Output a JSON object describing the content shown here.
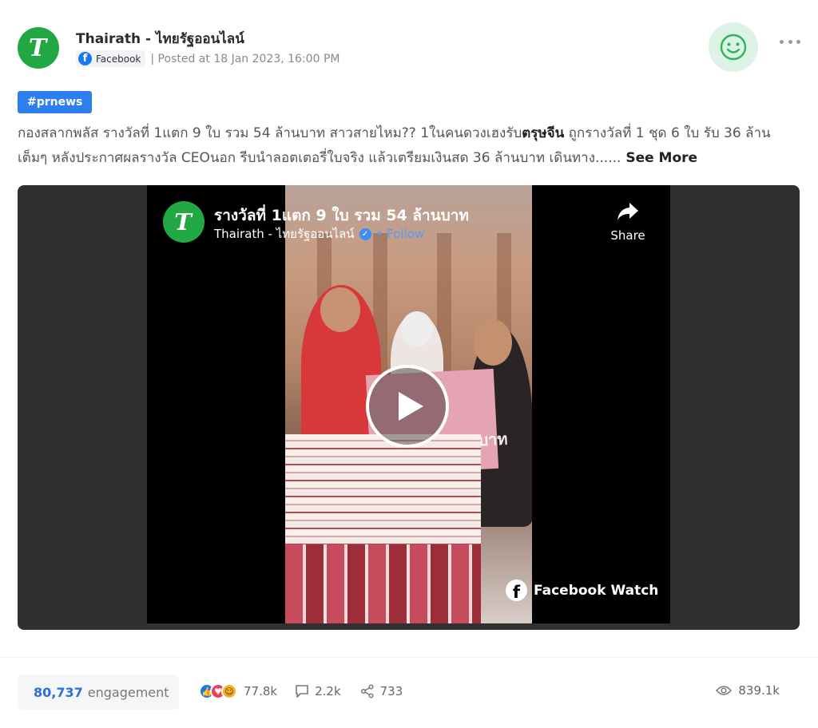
{
  "post": {
    "page_name": "Thairath - ไทยรัฐออนไลน์",
    "avatar_letter": "T",
    "source": "Facebook",
    "posted": "| Posted at 18 Jan 2023, 16:00 PM",
    "hashtag": "#prnews",
    "caption_part1": "กองสลากพลัส รางวัลที่ 1แตก 9 ใบ รวม 54 ล้านบาท  สาวสายไหม?? 1ในคนดวงเฮงรับ",
    "caption_bold": "ตรุษจีน",
    "caption_part2": " ถูกรางวัลที่ 1 ชุด 6 ใบ รับ 36 ล้านเต็มๆ  หลังประกาศผลรางวัล CEOนอก รีบนำลอตเตอรี่ใบจริง แล้วเตรียมเงินสด 36 ล้านบาท เดินทาง......",
    "see_more": " See More"
  },
  "video": {
    "title": "รางวัลที่ 1แตก 9 ใบ รวม 54 ล้านบาท",
    "channel": "Thairath - ไทยรัฐออนไลน์",
    "follow": "• Follow",
    "share": "Share",
    "watermark": "Facebook Watch",
    "board_text": "36,000,000 บาท"
  },
  "stats": {
    "engagement_value": "80,737",
    "engagement_label": "engagement",
    "reactions": "77.8k",
    "comments": "2.2k",
    "shares": "733",
    "views": "839.1k"
  },
  "colors": {
    "brand_green": "#22a843",
    "hashtag_blue": "#2d7ff0",
    "facebook_blue": "#1877f2"
  }
}
